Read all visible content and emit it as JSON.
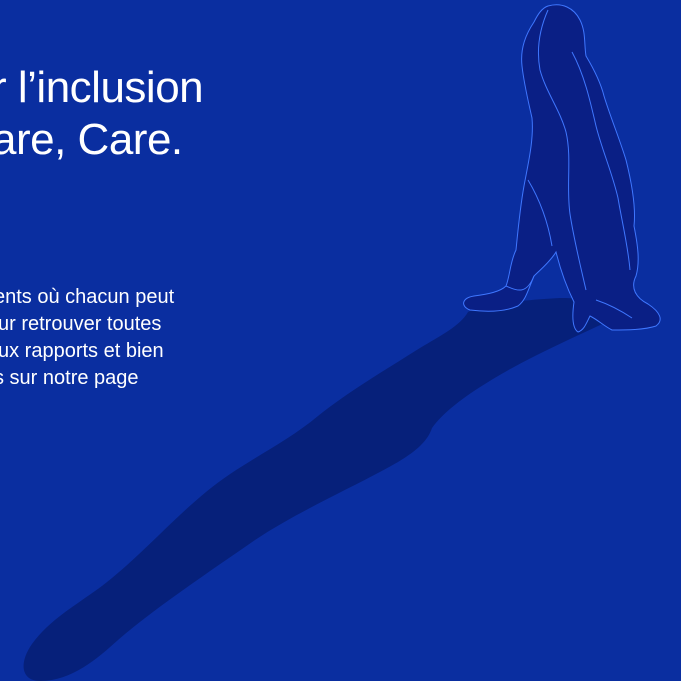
{
  "hero": {
    "heading_line1": "r l’inclusion",
    "heading_line2": "are, Care.",
    "paragraph_lines": [
      "ents où chacun peut",
      "ur retrouver toutes",
      "ux rapports et bien",
      "s sur notre page"
    ]
  },
  "colors": {
    "background": "#0a2ea0",
    "shadow": "#06207a",
    "figure": "#0a1f85",
    "outline": "#3f77ff",
    "text": "#ffffff"
  },
  "icons": {
    "illustration": "walking-woman-shadow-illustration"
  }
}
